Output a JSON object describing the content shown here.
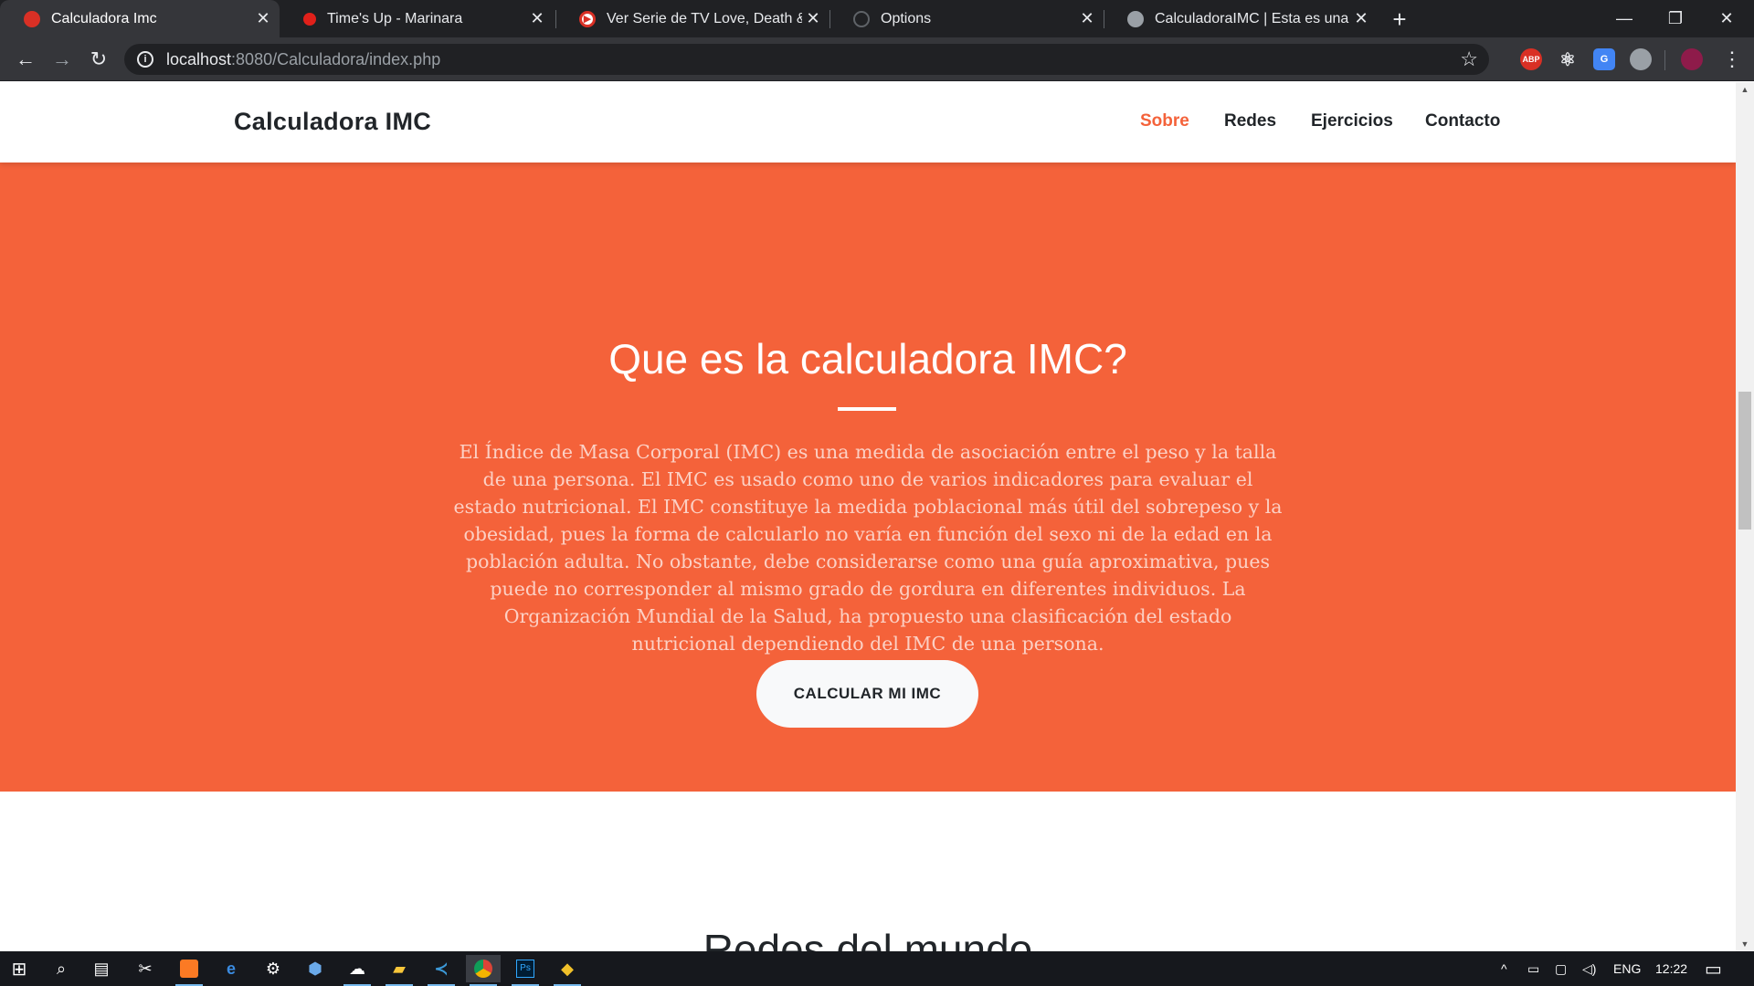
{
  "browser": {
    "tabs": [
      {
        "title": "Calculadora Imc",
        "active": true
      },
      {
        "title": "Time's Up - Marinara",
        "active": false
      },
      {
        "title": "Ver Serie de TV Love, Death & Robots",
        "active": false
      },
      {
        "title": "Options",
        "active": false
      },
      {
        "title": "CalculadoraIMC | Esta es una calculadora",
        "active": false
      }
    ],
    "url_host": "localhost",
    "url_path": ":8080/Calculadora/index.php",
    "extensions": [
      "adblock-plus",
      "react-devtools",
      "google-translate",
      "extension",
      "profile-avatar"
    ]
  },
  "site": {
    "brand": "Calculadora IMC",
    "menu": [
      {
        "label": "Sobre",
        "active": true
      },
      {
        "label": "Redes",
        "active": false
      },
      {
        "label": "Ejercicios",
        "active": false
      },
      {
        "label": "Contacto",
        "active": false
      }
    ],
    "about": {
      "title": "Que es la calculadora IMC?",
      "text": "El Índice de Masa Corporal (IMC) es una medida de asociación entre el peso y la talla de una persona. El IMC es usado como uno de varios indicadores para evaluar el estado nutricional. El IMC constituye la medida poblacional más útil del sobrepeso y la obesidad, pues la forma de calcularlo no varía en función del sexo ni de la edad en la población adulta. No obstante, debe considerarse como una guía aproximativa, pues puede no corresponder al mismo grado de gordura en diferentes individuos. La Organización Mundial de la Salud, ha propuesto una clasificación del estado nutricional dependiendo del IMC de una persona.",
      "cta": "CALCULAR MI IMC"
    },
    "next_heading": "Redes del mundo"
  },
  "taskbar": {
    "language": "ENG",
    "time": "12:22"
  },
  "colors": {
    "accent": "#f4623a",
    "chrome_dark": "#202124",
    "chrome_toolbar": "#35363a"
  }
}
